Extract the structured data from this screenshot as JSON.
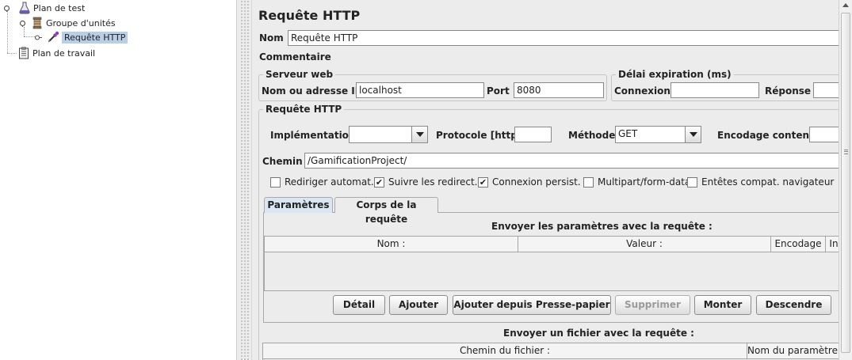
{
  "tree": {
    "items": [
      {
        "label": "Plan de test",
        "icon": "flask-icon"
      },
      {
        "label": "Groupe d'unités",
        "icon": "spool-icon"
      },
      {
        "label": "Requête HTTP",
        "icon": "pipette-icon",
        "selected": true
      },
      {
        "label": "Plan de travail",
        "icon": "clipboard-icon"
      }
    ]
  },
  "panel": {
    "title": "Requête HTTP",
    "name_label": "Nom :",
    "name_value": "Requête HTTP",
    "comments_label": "Commentaires :",
    "server": {
      "legend": "Serveur web",
      "host_label": "Nom ou adresse IP :",
      "host_value": "localhost",
      "port_label": "Port :",
      "port_value": "8080"
    },
    "timeout": {
      "legend": "Délai expiration (ms)",
      "connect_label": "Connexion :",
      "response_label": "Réponse :"
    },
    "request": {
      "legend": "Requête HTTP",
      "impl_label": "Implémentation :",
      "impl_value": "",
      "protocol_label": "Protocole [http] :",
      "protocol_value": "",
      "method_label": "Méthode :",
      "method_value": "GET",
      "encoding_label": "Encodage contenu :",
      "path_label": "Chemin :",
      "path_value": "/GamificationProject/"
    },
    "options": [
      {
        "label": "Rediriger automat.",
        "checked": false
      },
      {
        "label": "Suivre les redirect.",
        "checked": true
      },
      {
        "label": "Connexion persist.",
        "checked": true
      },
      {
        "label": "Multipart/form-data",
        "checked": false
      },
      {
        "label": "Entêtes compat. navigateur",
        "checked": false
      }
    ],
    "tabs": [
      {
        "label": "Paramètres",
        "active": true
      },
      {
        "label": "Corps de la requête",
        "active": false
      }
    ],
    "params": {
      "heading": "Envoyer les paramètres avec la requête :",
      "columns": [
        "Nom :",
        "Valeur :",
        "Encodage",
        "In"
      ]
    },
    "buttons": {
      "detail": "Détail",
      "add": "Ajouter",
      "add_clipboard": "Ajouter depuis Presse-papier",
      "delete": "Supprimer",
      "up": "Monter",
      "down": "Descendre"
    },
    "files": {
      "heading": "Envoyer un fichier avec la requête :",
      "columns": [
        "Chemin du fichier :",
        "Nom du paramètre :"
      ]
    }
  }
}
